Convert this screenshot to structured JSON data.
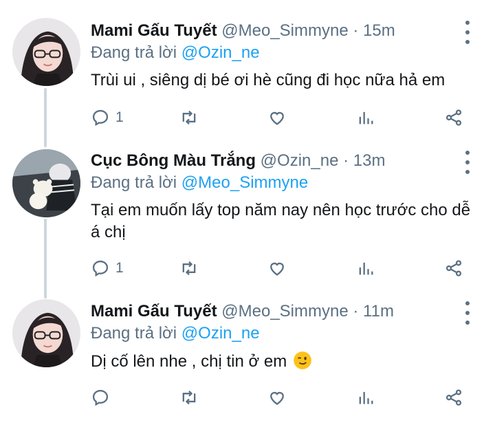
{
  "tweets": [
    {
      "name": "Mami Gấu Tuyết",
      "handle": "@Meo_Simmyne",
      "separator": "·",
      "time": "15m",
      "reply_prefix": "Đang trả lời",
      "reply_to": "@Ozin_ne",
      "text": "Trùi ui , siêng dị bé ơi hè cũng đi học nữa hả em",
      "reply_count": "1"
    },
    {
      "name": "Cục Bông Màu Trắng",
      "handle": "@Ozin_ne",
      "separator": "·",
      "time": "13m",
      "reply_prefix": "Đang trả lời",
      "reply_to": "@Meo_Simmyne",
      "text": "Tại em muốn lấy top năm nay nên học trước cho dễ á chị",
      "reply_count": "1"
    },
    {
      "name": "Mami Gấu Tuyết",
      "handle": "@Meo_Simmyne",
      "separator": "·",
      "time": "11m",
      "reply_prefix": "Đang trả lời",
      "reply_to": "@Ozin_ne",
      "text": "Dị cố lên nhe , chị tin ở em",
      "emoji": "winking-face",
      "reply_count": ""
    }
  ],
  "icons": [
    "reply-icon",
    "retweet-icon",
    "like-icon",
    "analytics-icon",
    "share-icon",
    "more-options-icon"
  ],
  "colors": {
    "mention": "#1da1f2",
    "secondary": "#5b7083",
    "thread_line": "#cdd6dd"
  }
}
